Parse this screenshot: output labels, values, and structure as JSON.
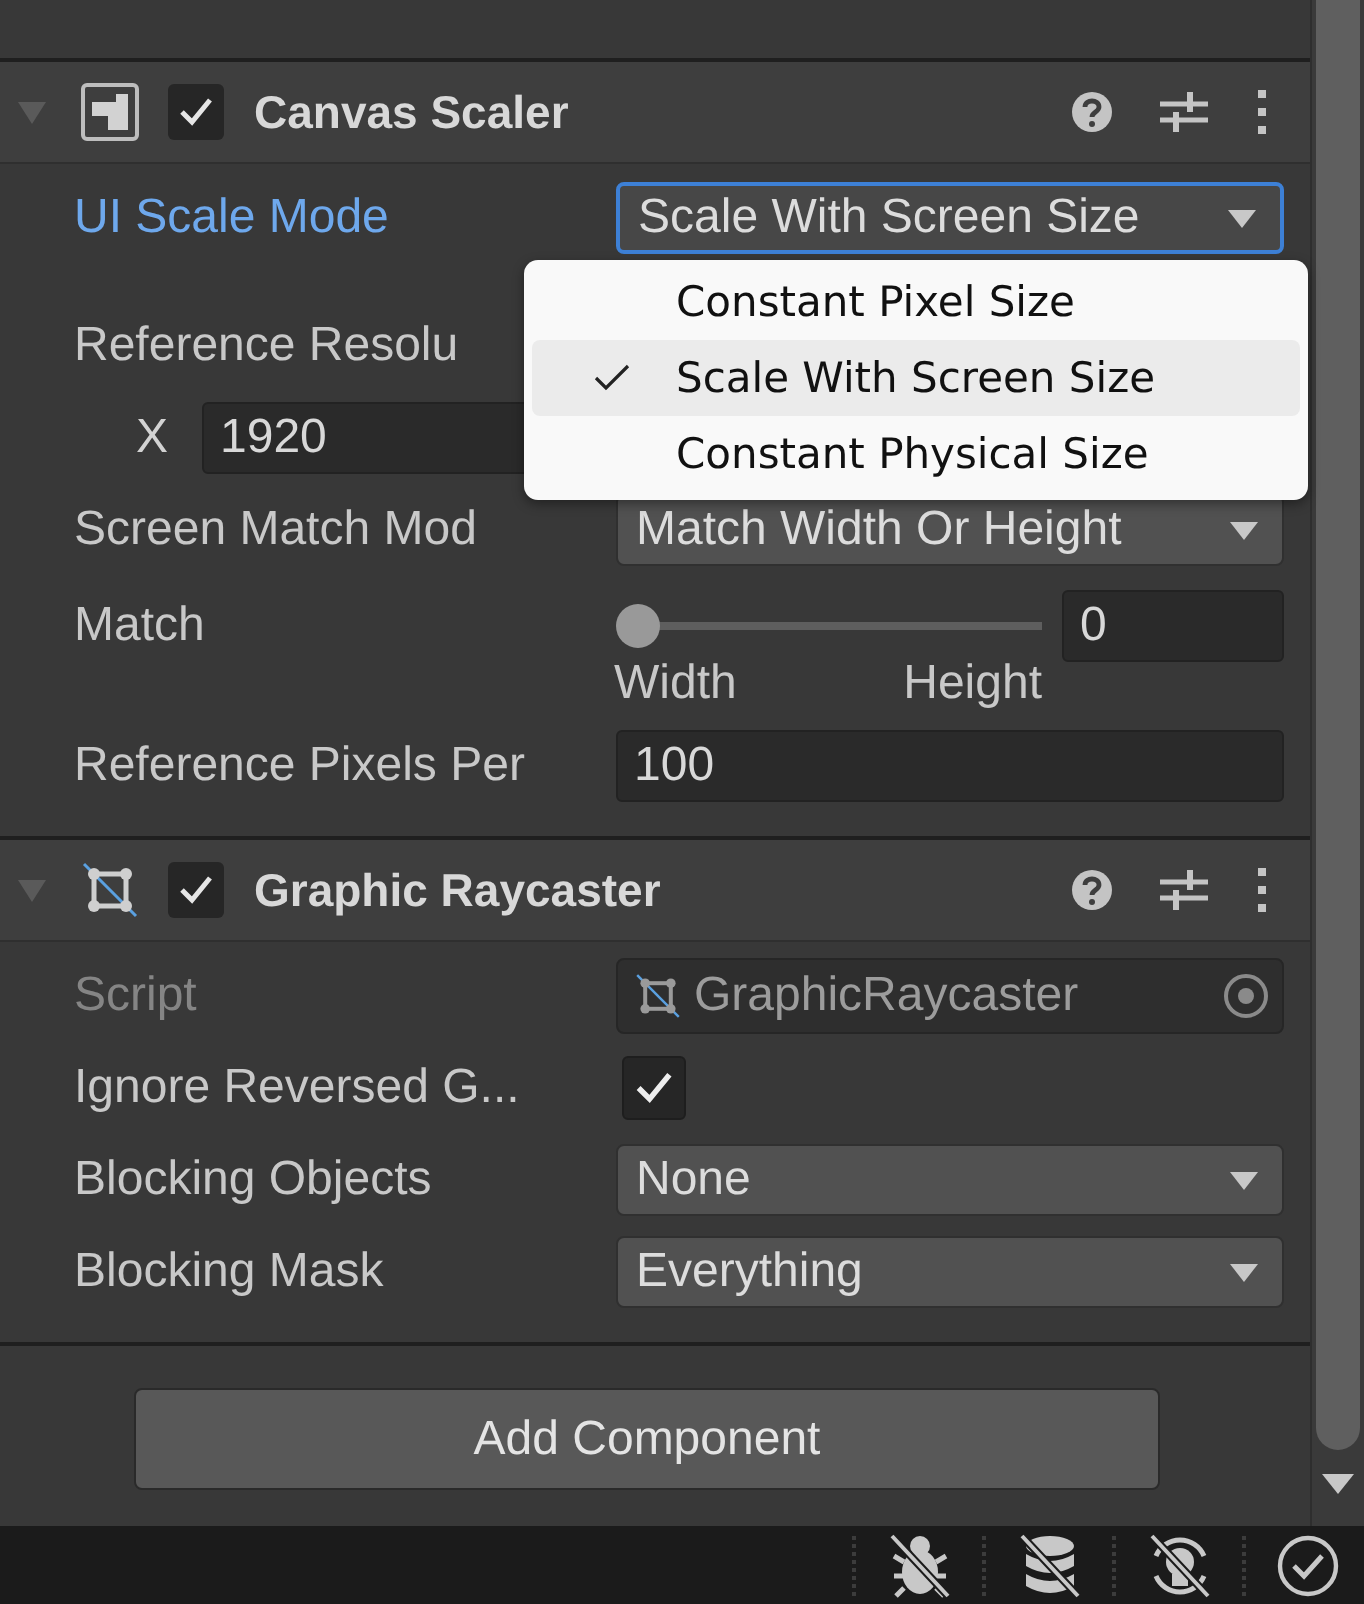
{
  "components": [
    {
      "title": "Canvas Scaler",
      "expanded": true,
      "enabled": true,
      "rows": [
        {
          "kind": "dropdown",
          "label": "UI Scale Mode",
          "value": "Scale With Screen Size",
          "focused": true
        },
        {
          "kind": "heading",
          "label": "Reference Resolu"
        },
        {
          "kind": "axis",
          "label": "X",
          "value": "1920"
        },
        {
          "kind": "dropdown",
          "label": "Screen Match Mod",
          "value": "Match Width Or Height",
          "focused": false
        },
        {
          "kind": "slider",
          "label": "Match",
          "level": 0,
          "value": "0",
          "min_label": "Width",
          "max_label": "Height"
        },
        {
          "kind": "field",
          "label": "Reference Pixels Per",
          "value": "100"
        }
      ]
    },
    {
      "title": "Graphic Raycaster",
      "expanded": true,
      "enabled": true,
      "rows": [
        {
          "kind": "object",
          "label": "Script",
          "value": "GraphicRaycaster",
          "disabled": true
        },
        {
          "kind": "checkbox",
          "label": "Ignore Reversed G...",
          "checked": true
        },
        {
          "kind": "dropdown",
          "label": "Blocking Objects",
          "value": "None",
          "focused": false
        },
        {
          "kind": "dropdown",
          "label": "Blocking Mask",
          "value": "Everything",
          "focused": false
        }
      ]
    }
  ],
  "popup": {
    "options": [
      {
        "label": "Constant Pixel Size",
        "selected": false
      },
      {
        "label": "Scale With Screen Size",
        "selected": true
      },
      {
        "label": "Constant Physical Size",
        "selected": false
      }
    ]
  },
  "add_button": "Add Component"
}
